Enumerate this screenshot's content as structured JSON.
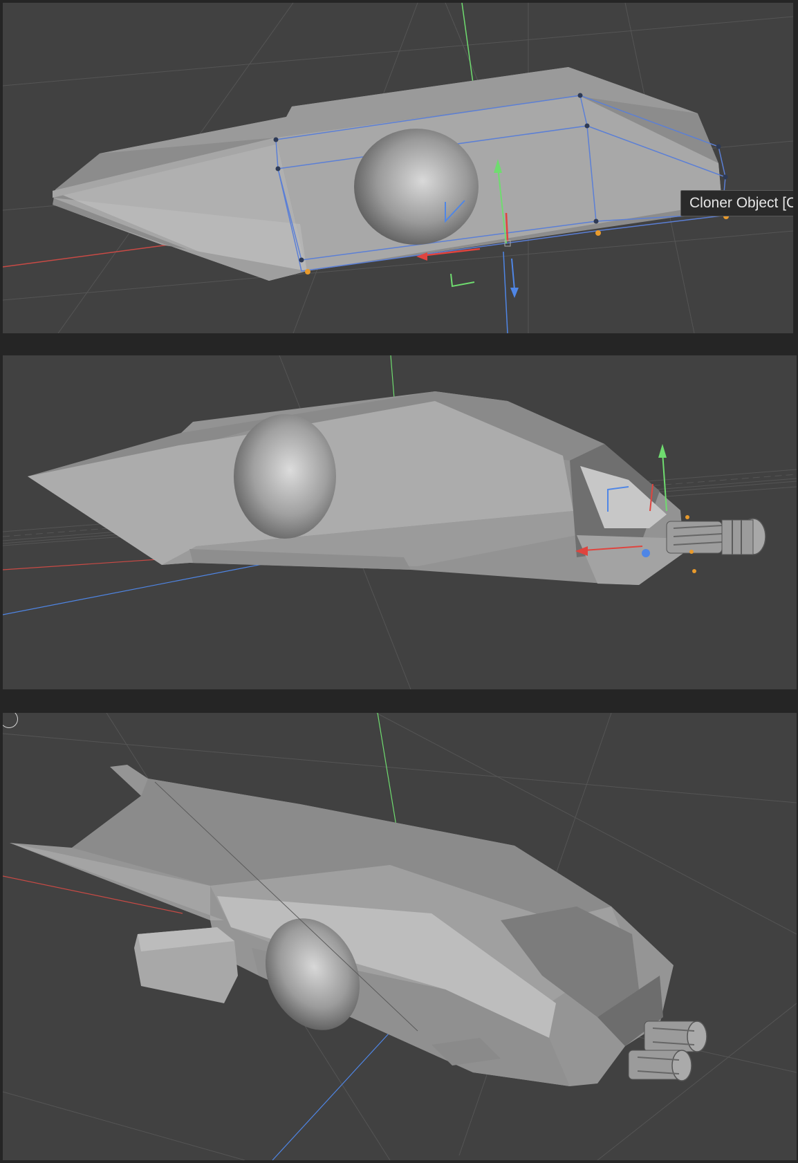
{
  "tooltip": {
    "text": "Cloner Object [C"
  },
  "colors": {
    "background": "#252525",
    "viewport": "#414141",
    "grid": "#555555",
    "x_axis": "#e0443e",
    "y_axis": "#6fdc6f",
    "z_axis": "#4f86e6",
    "selection": "#5b7fd6",
    "handle": "#e89a2c"
  },
  "icons": {
    "move_gizmo": "move-gizmo-icon",
    "axis_marker": "axis-corner-icon",
    "point_handle": "point-handle-icon"
  }
}
